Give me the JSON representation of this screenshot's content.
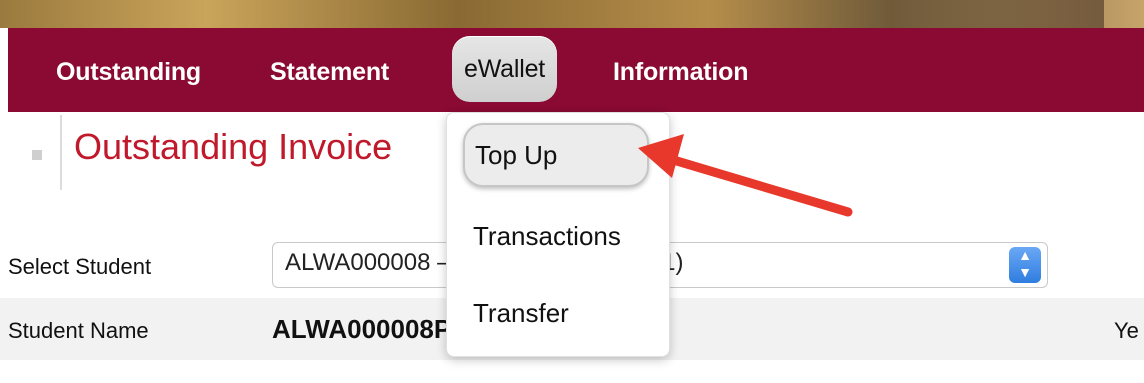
{
  "nav": {
    "items": [
      {
        "label": "Outstanding"
      },
      {
        "label": "Statement"
      },
      {
        "label": "eWallet"
      },
      {
        "label": "Information"
      }
    ]
  },
  "page": {
    "title": "Outstanding Invoice"
  },
  "form": {
    "select_student_label": "Select Student",
    "student_select_value": "ALWA000008 – ALWA000008P (C01)",
    "student_name_label": "Student Name",
    "student_name_value": "ALWA000008P, ALWA000008P",
    "year_label": "Ye"
  },
  "ewallet_menu": {
    "items": [
      {
        "label": "Top Up"
      },
      {
        "label": "Transactions"
      },
      {
        "label": "Transfer"
      }
    ]
  },
  "colors": {
    "nav_bg": "#8a0a33",
    "title_red": "#c0192b",
    "annotation_arrow": "#e8382c"
  },
  "icons": {
    "select_arrow": "chevron-up-down-icon",
    "annotation": "red-arrow-icon"
  }
}
